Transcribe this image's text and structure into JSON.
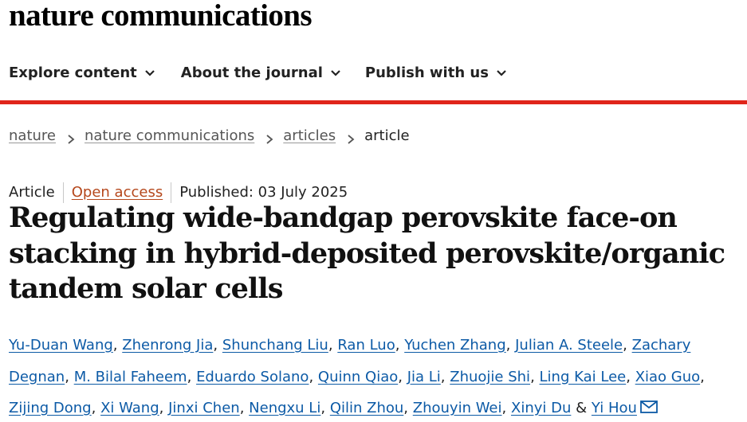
{
  "header": {
    "logo_text": "nature communications"
  },
  "nav": {
    "items": [
      {
        "label": "Explore content",
        "icon": "chevron-down-icon"
      },
      {
        "label": "About the journal",
        "icon": "chevron-down-icon"
      },
      {
        "label": "Publish with us",
        "icon": "chevron-down-icon"
      }
    ]
  },
  "colors": {
    "accent_rule": "#e0251b",
    "author_link": "#0c5aa6",
    "open_access": "#b5471b"
  },
  "breadcrumb": {
    "items": [
      "nature",
      "nature communications",
      "articles"
    ],
    "current": "article",
    "separator_icon": "chevron-right-icon"
  },
  "article": {
    "type": "Article",
    "access": "Open access",
    "published": "Published: 03 July 2025",
    "title": "Regulating wide-bandgap perovskite face-on stacking in hybrid-deposited perovskite/organic tandem solar cells",
    "authors": [
      "Yu-Duan Wang",
      "Zhenrong Jia",
      "Shunchang Liu",
      "Ran Luo",
      "Yuchen Zhang",
      "Julian A. Steele",
      "Zachary Degnan",
      "M. Bilal Faheem",
      "Eduardo Solano",
      "Quinn Qiao",
      "Jia Li",
      "Zhuojie Shi",
      "Ling Kai Lee",
      "Xiao Guo",
      "Zijing Dong",
      "Xi Wang",
      "Jinxi Chen",
      "Nengxu Li",
      "Qilin Zhou",
      "Zhouyin Wei",
      "Xinyi Du",
      "Yi Hou"
    ],
    "author_separator": ",",
    "last_author_joiner": "&",
    "corresponding_icon": "mail-icon"
  }
}
